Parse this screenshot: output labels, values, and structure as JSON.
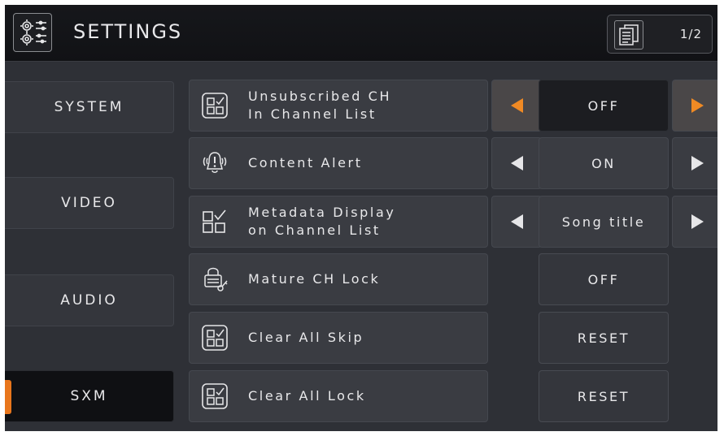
{
  "header": {
    "title": "SETTINGS",
    "page_indicator": "1/2",
    "settings_icon": "settings-gears-icon",
    "page_icon": "page-list-icon"
  },
  "sidebar": {
    "items": [
      {
        "label": "SYSTEM",
        "active": false
      },
      {
        "label": "VIDEO",
        "active": false
      },
      {
        "label": "AUDIO",
        "active": false
      },
      {
        "label": "SXM",
        "active": true
      }
    ]
  },
  "settings": [
    {
      "line1": "Unsubscribed CH",
      "line2": "In Channel List",
      "value": "OFF",
      "icon": "checklist-icon",
      "control": "selector"
    },
    {
      "line1": "Content Alert",
      "line2": "",
      "value": "ON",
      "icon": "bell-alert-icon",
      "control": "selector"
    },
    {
      "line1": "Metadata Display",
      "line2": "on Channel List",
      "value": "Song title",
      "icon": "checklist-icon",
      "control": "selector"
    },
    {
      "line1": "Mature CH Lock",
      "line2": "",
      "value": "OFF",
      "icon": "lock-key-icon",
      "control": "toggle"
    },
    {
      "line1": "Clear All Skip",
      "line2": "",
      "value": "RESET",
      "icon": "checklist-icon",
      "control": "button"
    },
    {
      "line1": "Clear All Lock",
      "line2": "",
      "value": "RESET",
      "icon": "checklist-icon",
      "control": "button"
    }
  ],
  "colors": {
    "accent": "#f08a24",
    "background": "#2e3036",
    "header": "#131417"
  }
}
